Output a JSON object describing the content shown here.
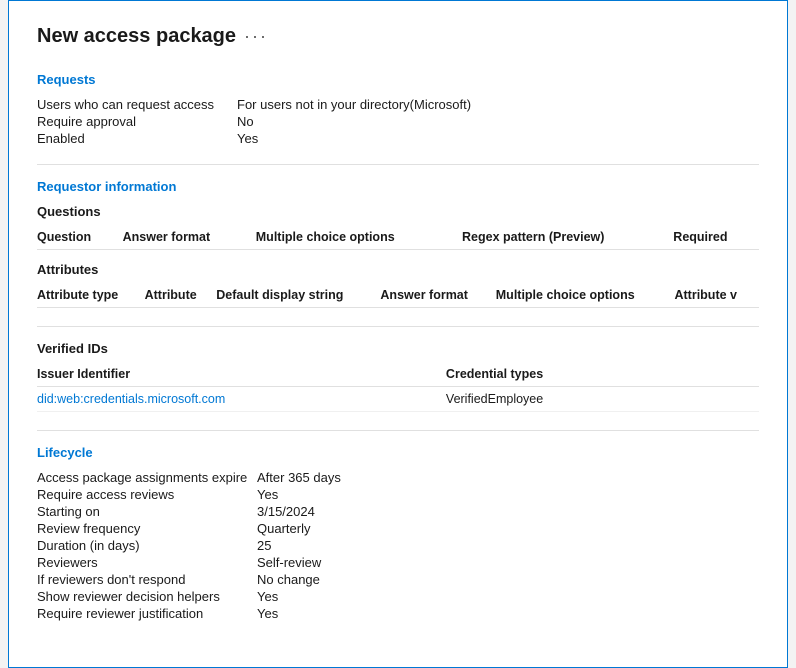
{
  "page": {
    "title": "New access package",
    "more_icon": "···"
  },
  "requests_section": {
    "title": "Requests",
    "fields": [
      {
        "label": "Users who can request access",
        "value": "For users not in your directory(Microsoft)"
      },
      {
        "label": "Require approval",
        "value": "No"
      },
      {
        "label": "Enabled",
        "value": "Yes"
      }
    ]
  },
  "requestor_section": {
    "title": "Requestor information",
    "questions_subsection": {
      "title": "Questions",
      "columns": [
        "Question",
        "Answer format",
        "Multiple choice options",
        "Regex pattern (Preview)",
        "Required"
      ],
      "rows": []
    },
    "attributes_subsection": {
      "title": "Attributes",
      "columns": [
        "Attribute type",
        "Attribute",
        "Default display string",
        "Answer format",
        "Multiple choice options",
        "Attribute v"
      ],
      "rows": []
    }
  },
  "verified_ids_section": {
    "title": "Verified IDs",
    "columns": [
      "Issuer Identifier",
      "Credential types"
    ],
    "rows": [
      {
        "issuer": "did:web:credentials.microsoft.com",
        "credential": "VerifiedEmployee"
      }
    ]
  },
  "lifecycle_section": {
    "title": "Lifecycle",
    "fields": [
      {
        "label": "Access package assignments expire",
        "value": "After 365 days"
      },
      {
        "label": "Require access reviews",
        "value": "Yes"
      },
      {
        "label": "Starting on",
        "value": "3/15/2024"
      },
      {
        "label": "Review frequency",
        "value": "Quarterly"
      },
      {
        "label": "Duration (in days)",
        "value": "25"
      },
      {
        "label": "Reviewers",
        "value": "Self-review"
      },
      {
        "label": "If reviewers don't respond",
        "value": "No change"
      },
      {
        "label": "Show reviewer decision helpers",
        "value": "Yes"
      },
      {
        "label": "Require reviewer justification",
        "value": "Yes"
      }
    ]
  }
}
